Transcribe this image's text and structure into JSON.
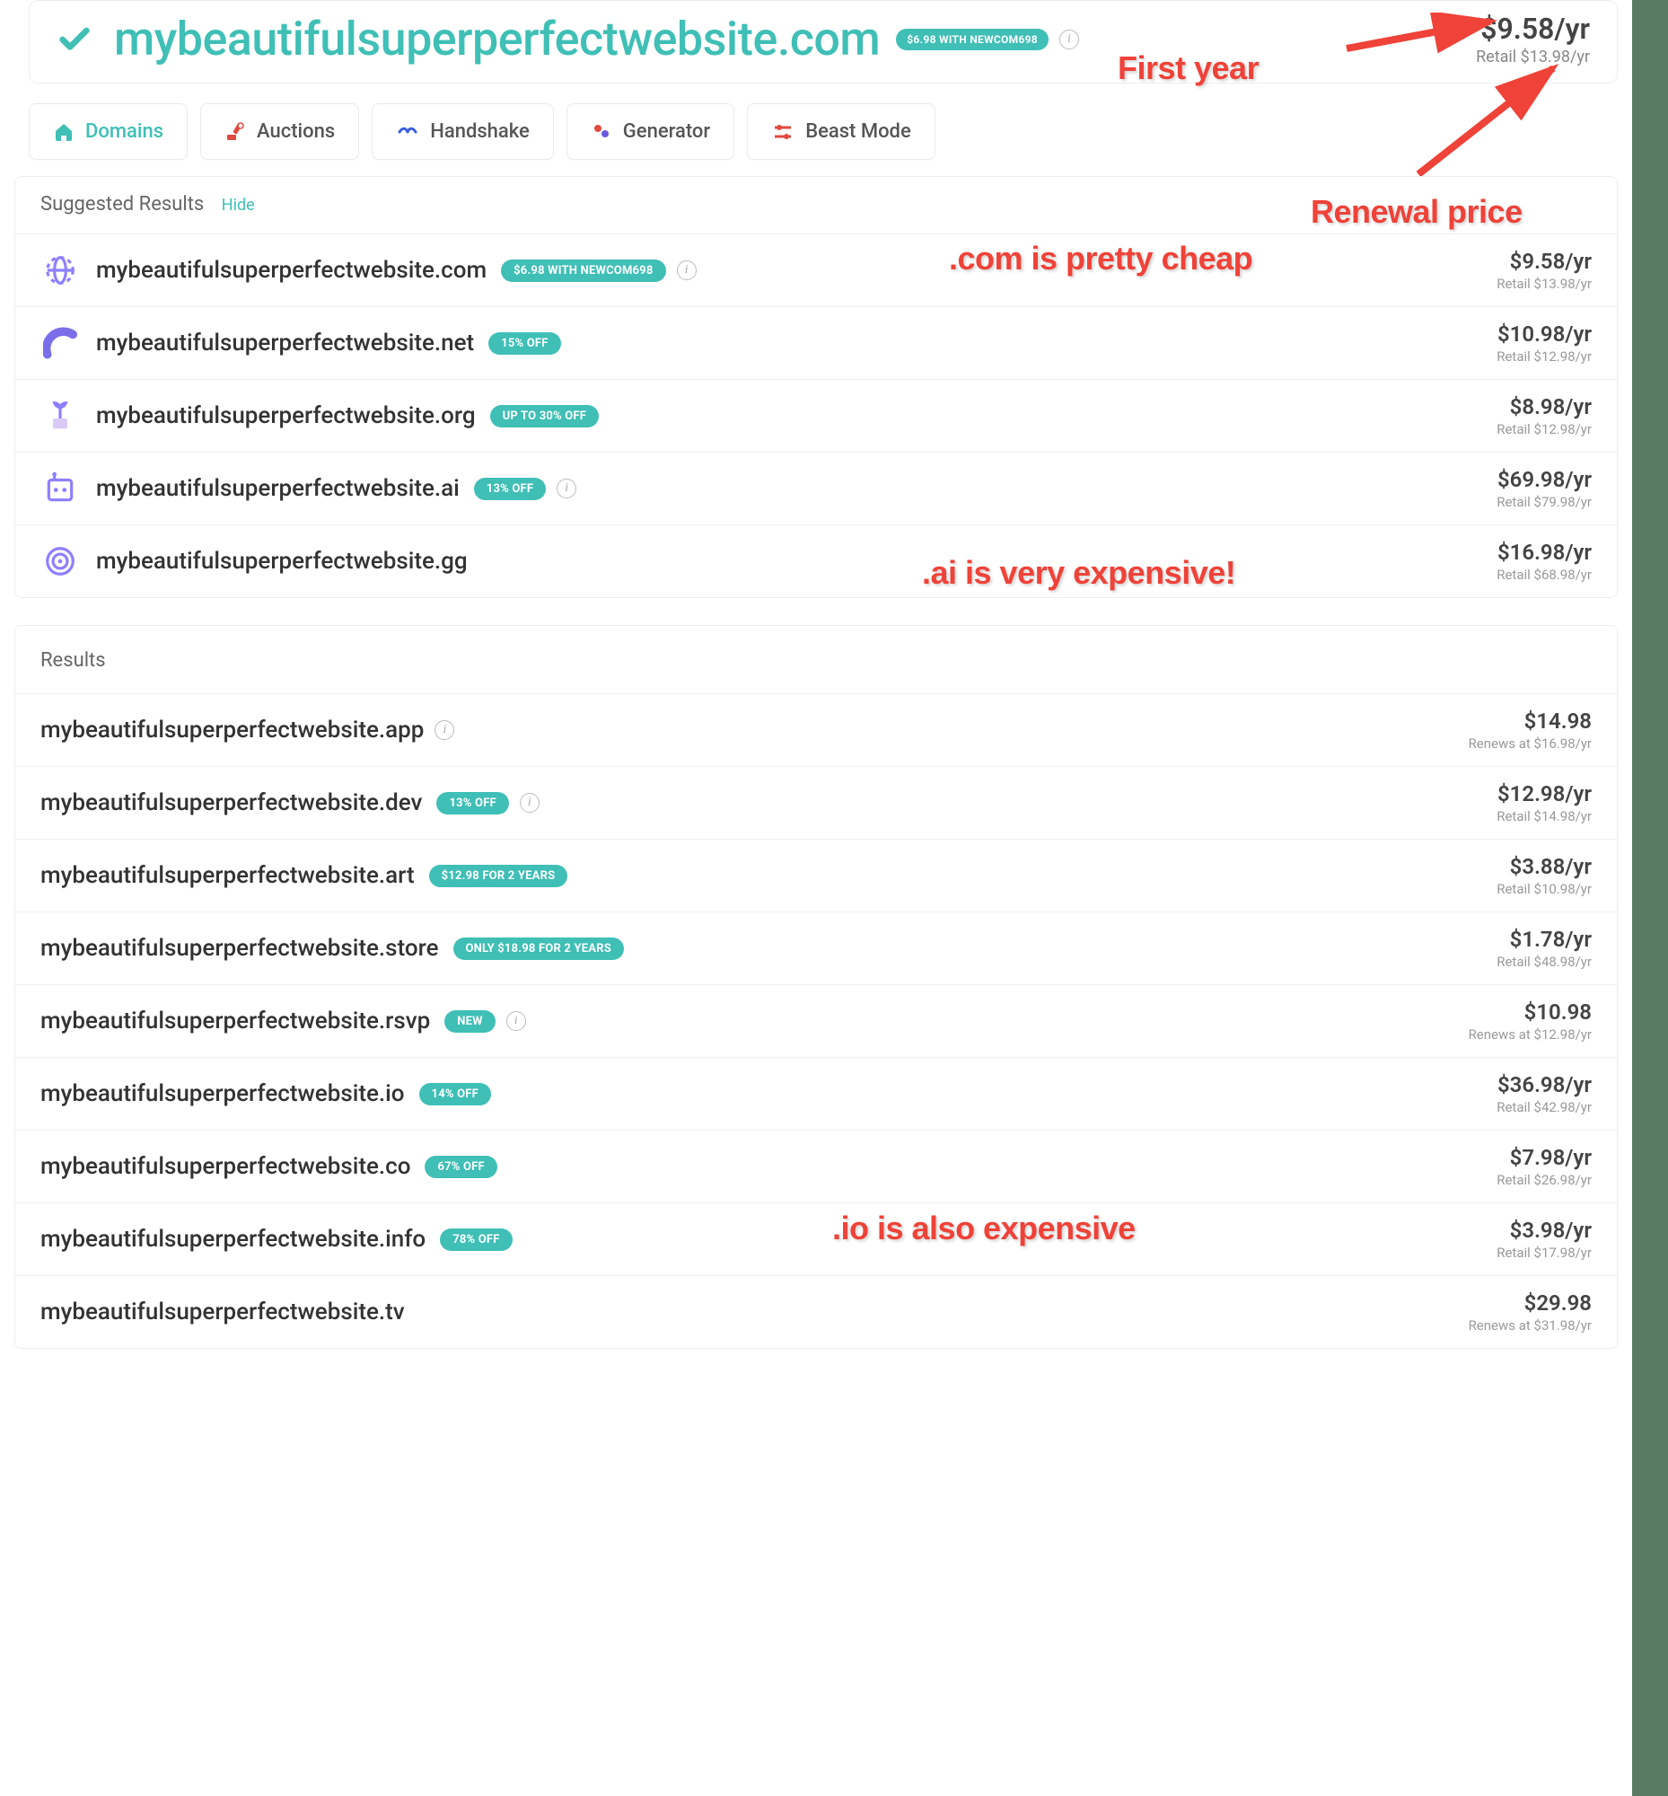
{
  "header": {
    "domain": "mybeautifulsuperperfectwebsite.com",
    "coupon": "$6.98 WITH NEWCOM698",
    "price": "$9.58/yr",
    "retail": "Retail $13.98/yr"
  },
  "tabs": [
    {
      "label": "Domains",
      "icon": "home"
    },
    {
      "label": "Auctions",
      "icon": "auction"
    },
    {
      "label": "Handshake",
      "icon": "handshake"
    },
    {
      "label": "Generator",
      "icon": "generator"
    },
    {
      "label": "Beast Mode",
      "icon": "beast"
    }
  ],
  "suggested": {
    "title": "Suggested Results",
    "hide": "Hide",
    "items": [
      {
        "name": "mybeautifulsuperperfectwebsite.com",
        "badge": "$6.98 WITH NEWCOM698",
        "info": true,
        "price": "$9.58/yr",
        "retail": "Retail $13.98/yr",
        "icon": "globe"
      },
      {
        "name": "mybeautifulsuperperfectwebsite.net",
        "badge": "15% OFF",
        "info": false,
        "price": "$10.98/yr",
        "retail": "Retail $12.98/yr",
        "icon": "arc"
      },
      {
        "name": "mybeautifulsuperperfectwebsite.org",
        "badge": "UP TO 30% OFF",
        "info": false,
        "price": "$8.98/yr",
        "retail": "Retail $12.98/yr",
        "icon": "plant"
      },
      {
        "name": "mybeautifulsuperperfectwebsite.ai",
        "badge": "13% OFF",
        "info": true,
        "price": "$69.98/yr",
        "retail": "Retail $79.98/yr",
        "icon": "robot"
      },
      {
        "name": "mybeautifulsuperperfectwebsite.gg",
        "badge": "",
        "info": false,
        "price": "$16.98/yr",
        "retail": "Retail $68.98/yr",
        "icon": "target"
      }
    ]
  },
  "results": {
    "title": "Results",
    "items": [
      {
        "name": "mybeautifulsuperperfectwebsite.app",
        "badge": "",
        "info": true,
        "price": "$14.98",
        "retail": "Renews at $16.98/yr"
      },
      {
        "name": "mybeautifulsuperperfectwebsite.dev",
        "badge": "13% OFF",
        "info": true,
        "price": "$12.98/yr",
        "retail": "Retail $14.98/yr"
      },
      {
        "name": "mybeautifulsuperperfectwebsite.art",
        "badge": "$12.98 FOR 2 YEARS",
        "info": false,
        "price": "$3.88/yr",
        "retail": "Retail $10.98/yr"
      },
      {
        "name": "mybeautifulsuperperfectwebsite.store",
        "badge": "ONLY $18.98 FOR 2 YEARS",
        "info": false,
        "price": "$1.78/yr",
        "retail": "Retail $48.98/yr"
      },
      {
        "name": "mybeautifulsuperperfectwebsite.rsvp",
        "badge": "NEW",
        "info": true,
        "price": "$10.98",
        "retail": "Renews at $12.98/yr"
      },
      {
        "name": "mybeautifulsuperperfectwebsite.io",
        "badge": "14% OFF",
        "info": false,
        "price": "$36.98/yr",
        "retail": "Retail $42.98/yr"
      },
      {
        "name": "mybeautifulsuperperfectwebsite.co",
        "badge": "67% OFF",
        "info": false,
        "price": "$7.98/yr",
        "retail": "Retail $26.98/yr"
      },
      {
        "name": "mybeautifulsuperperfectwebsite.info",
        "badge": "78% OFF",
        "info": false,
        "price": "$3.98/yr",
        "retail": "Retail $17.98/yr"
      },
      {
        "name": "mybeautifulsuperperfectwebsite.tv",
        "badge": "",
        "info": false,
        "price": "$29.98",
        "retail": "Renews at $31.98/yr"
      }
    ]
  },
  "annotations": {
    "first_year": "First year",
    "renewal_price": "Renewal price",
    "com_cheap": ".com is pretty cheap",
    "ai_expensive": ".ai is very expensive!",
    "io_expensive": ".io is also expensive"
  }
}
